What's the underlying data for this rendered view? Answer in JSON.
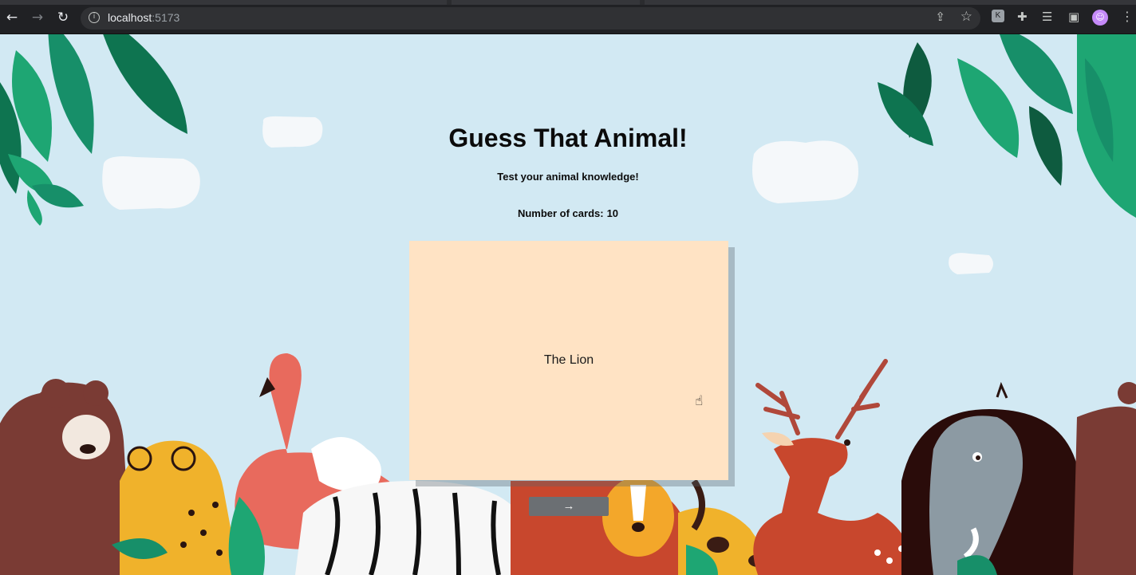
{
  "browser": {
    "url_host": "localhost",
    "url_port": ":5173",
    "icons": {
      "back": "arrow-left-icon",
      "forward": "arrow-right-icon",
      "reload": "reload-icon",
      "info": "info-icon",
      "share": "share-icon",
      "bookmark": "star-icon",
      "extension_k": "K",
      "extensions": "puzzle-icon",
      "media": "media-icon",
      "side_panel": "side-panel-icon",
      "menu": "kebab-menu-icon"
    }
  },
  "page": {
    "title": "Guess That Animal!",
    "subtitle": "Test your animal knowledge!",
    "count_label": "Number of cards:",
    "count_value": "10",
    "card_text": "The Lion",
    "next_label": "→"
  },
  "colors": {
    "sky": "#d2e9f3",
    "card": "#ffe3c4",
    "button": "#6b6f73"
  }
}
